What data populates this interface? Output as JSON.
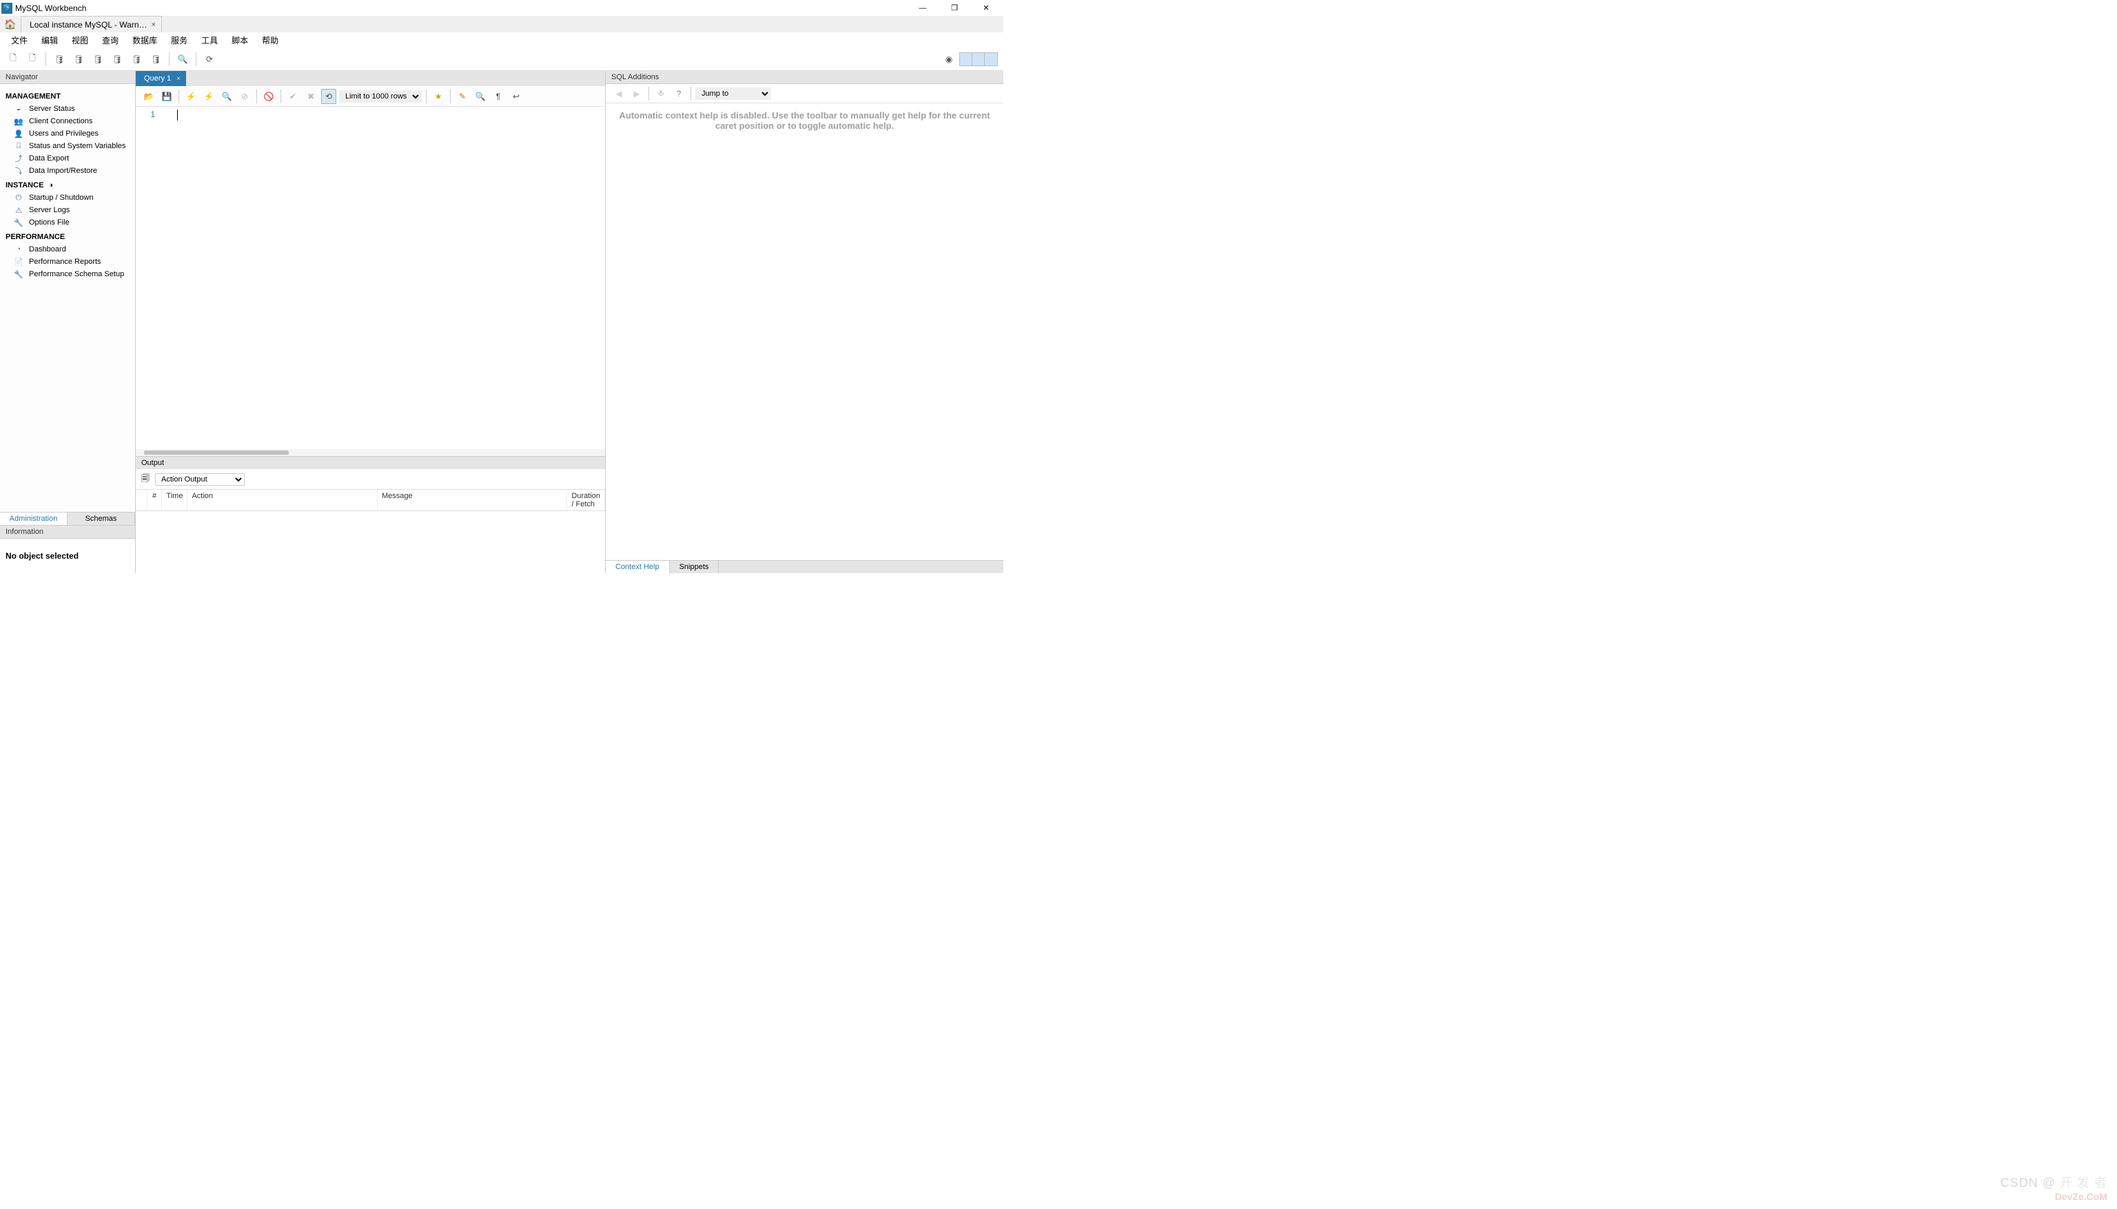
{
  "app": {
    "title": "MySQL Workbench"
  },
  "window_controls": {
    "minimize": "—",
    "maximize": "❐",
    "close": "✕"
  },
  "connection_tab": {
    "label": "Local instance MySQL - Warn…"
  },
  "menu": [
    "文件",
    "编辑",
    "视图",
    "查询",
    "数据库",
    "服务",
    "工具",
    "脚本",
    "帮助"
  ],
  "navigator": {
    "title": "Navigator",
    "management": {
      "heading": "MANAGEMENT",
      "items": [
        {
          "label": "Server Status",
          "icon": "◒"
        },
        {
          "label": "Client Connections",
          "icon": "👥"
        },
        {
          "label": "Users and Privileges",
          "icon": "👤"
        },
        {
          "label": "Status and System Variables",
          "icon": "⍈"
        },
        {
          "label": "Data Export",
          "icon": "⤴"
        },
        {
          "label": "Data Import/Restore",
          "icon": "⤵"
        }
      ]
    },
    "instance": {
      "heading": "INSTANCE",
      "items": [
        {
          "label": "Startup / Shutdown",
          "icon": "⏻"
        },
        {
          "label": "Server Logs",
          "icon": "⚠"
        },
        {
          "label": "Options File",
          "icon": "🔧"
        }
      ]
    },
    "performance": {
      "heading": "PERFORMANCE",
      "items": [
        {
          "label": "Dashboard",
          "icon": "◔"
        },
        {
          "label": "Performance Reports",
          "icon": "📄"
        },
        {
          "label": "Performance Schema Setup",
          "icon": "🔧"
        }
      ]
    },
    "tabs": {
      "administration": "Administration",
      "schemas": "Schemas"
    }
  },
  "information": {
    "title": "Information",
    "body": "No object selected"
  },
  "query": {
    "tab_label": "Query 1",
    "line_number": "1",
    "limit_options": [
      "Limit to 1000 rows"
    ],
    "limit_selected": "Limit to 1000 rows"
  },
  "sql_additions": {
    "title": "SQL Additions",
    "jump_label": "Jump to",
    "help_text": "Automatic context help is disabled. Use the toolbar to manually get help for the current caret position or to toggle automatic help.",
    "tabs": {
      "context": "Context Help",
      "snippets": "Snippets"
    }
  },
  "output": {
    "title": "Output",
    "selector": "Action Output",
    "columns": [
      "",
      "#",
      "Time",
      "Action",
      "Message",
      "Duration / Fetch"
    ]
  },
  "watermark": {
    "line1": "CSDN @",
    "line2": "开 发 者",
    "line3": "DevZe.CoM"
  }
}
